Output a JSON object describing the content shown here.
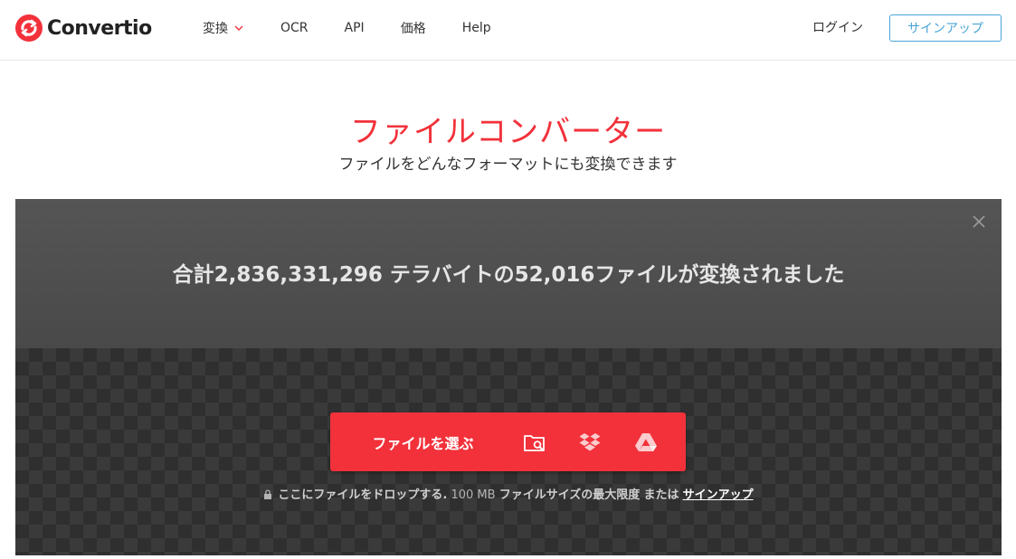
{
  "header": {
    "logo_text": "Convertio",
    "nav": [
      {
        "label": "変換",
        "has_dropdown": true
      },
      {
        "label": "OCR"
      },
      {
        "label": "API"
      },
      {
        "label": "価格"
      },
      {
        "label": "Help"
      }
    ],
    "login_label": "ログイン",
    "signup_label": "サインアップ"
  },
  "hero": {
    "title": "ファイルコンバーター",
    "subtitle": "ファイルをどんなフォーマットにも変換できます"
  },
  "stats": {
    "text": "合計2,836,331,296 テラバイトの52,016ファイルが変換されました"
  },
  "upload": {
    "choose_label": "ファイルを選ぶ",
    "sources": [
      "folder-search-icon",
      "dropbox-icon",
      "google-drive-icon"
    ],
    "drop_text": "ここにファイルをドロップする.",
    "size_text": "100 MB",
    "limit_text": "ファイルサイズの最大限度",
    "or_text": "または",
    "signup_link": "サインアップ"
  },
  "colors": {
    "brand_red": "#f2313a",
    "signup_blue": "#4aa5d8",
    "panel_dark": "#2f2f2f"
  }
}
